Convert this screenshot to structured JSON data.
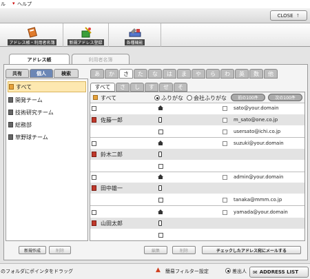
{
  "menu": {
    "item1": "ル",
    "item2": "ヘルプ"
  },
  "window": {
    "close_label": "CLOSE"
  },
  "toolbar": {
    "addressbook": "アドレス帳・利用者名簿",
    "new_address": "新規アドレス登録",
    "settings": "各種機能"
  },
  "tabs": {
    "addressbook": "アドレス帳",
    "users": "利用者名簿"
  },
  "left_tabs": {
    "shared": "共有",
    "personal": "個人",
    "search": "検索"
  },
  "groups": [
    "すべて",
    "開発チーム",
    "技術研究チーム",
    "総務部",
    "草野球チーム"
  ],
  "kana_tabs": [
    "あ",
    "か",
    "さ",
    "た",
    "な",
    "は",
    "ま",
    "や",
    "ら",
    "わ",
    "英",
    "数",
    "他"
  ],
  "kana_active": 2,
  "sub_tabs": [
    "すべて",
    "さ",
    "し",
    "す",
    "せ",
    "そ"
  ],
  "list_header": {
    "label": "すべて",
    "radio1": "ふりがな",
    "radio2": "会社ふりがな",
    "prev": "前の100件",
    "next": "次の100件"
  },
  "contacts": [
    {
      "name": "佐藤一郎",
      "emails": [
        "sato@your.domain",
        "m_sato@one.co.jp",
        "usersato@ichi.co.jp"
      ]
    },
    {
      "name": "鈴木二郎",
      "emails": [
        "suzuki@your.domain",
        "",
        ""
      ]
    },
    {
      "name": "田中雄一",
      "emails": [
        "admin@your.domain",
        "",
        "tanaka@mmm.co.jp"
      ]
    },
    {
      "name": "山田太郎",
      "emails": [
        "yamada@your.domain",
        "",
        ""
      ]
    }
  ],
  "buttons": {
    "new": "新規作成",
    "delete": "削除",
    "edit": "編集",
    "delete2": "削除",
    "send": "チェックしたアドレス宛にメールする"
  },
  "status": {
    "hint": "のフォルダにポインタをドラッグ",
    "filter": "簡易フィルター設定",
    "radio": "差出人",
    "address_list": "ADDRESS LIST"
  }
}
